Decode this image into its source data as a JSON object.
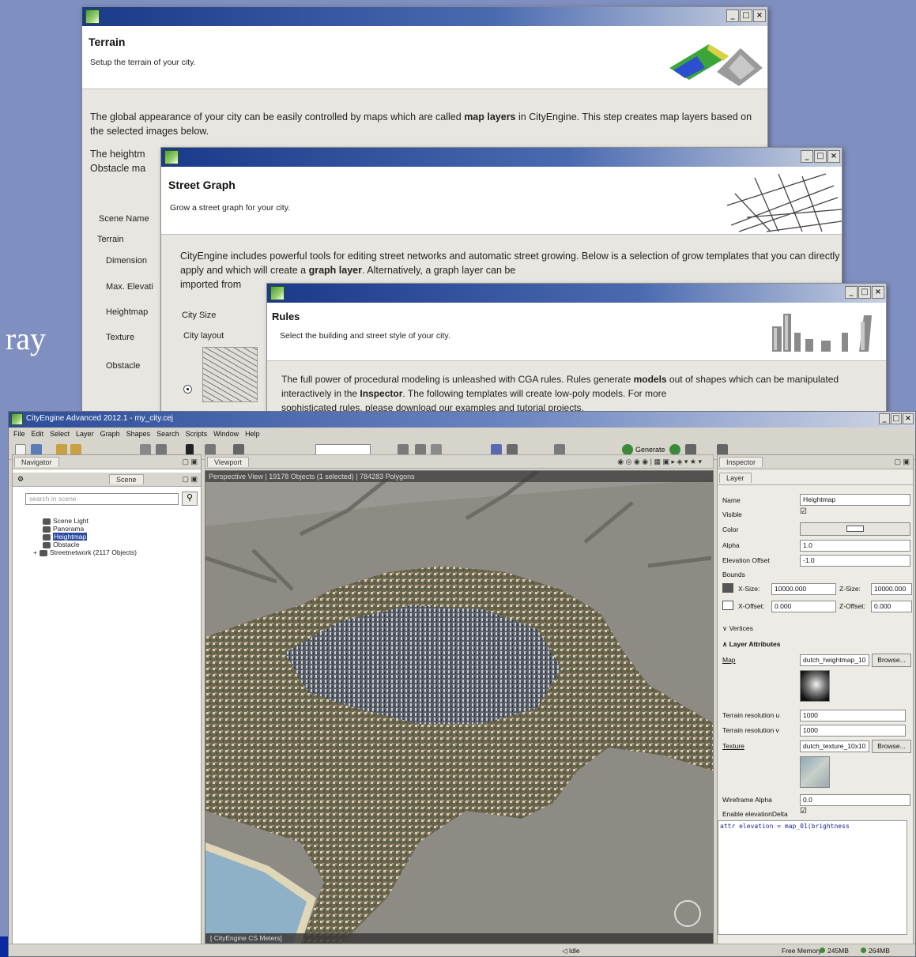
{
  "slide_text": "ray",
  "terrain_window": {
    "title": "Terrain",
    "subtitle": "Setup the terrain of your city.",
    "body": [
      "The global appearance of your city can be easily controlled by maps which are called ",
      "map layers",
      " in CityEngine. This step creates map layers based on the selected images below."
    ],
    "body2_line1": "The heightm",
    "body2_line2": "Obstacle ma",
    "scene_name_label": "Scene Name",
    "terrain_group": "Terrain",
    "labels": [
      "Dimension",
      "Max. Elevati",
      "Heightmap",
      "Texture",
      "Obstacle"
    ]
  },
  "street_window": {
    "title": "Street Graph",
    "subtitle": "Grow a street graph for your city.",
    "body_a": "CityEngine includes powerful tools for editing street networks and automatic street growing. Below is a selection of grow templates that you can directly apply and which will create a ",
    "body_bold": "graph layer",
    "body_b": ". Alternatively, a graph layer can be",
    "body_c": "imported from",
    "city_size_label": "City Size",
    "city_layout_label": "City layout"
  },
  "rules_window": {
    "title": "Rules",
    "subtitle": "Select the building and street style of your city.",
    "body_1a": "The full power of procedural modeling is unleashed with CGA rules. Rules generate ",
    "body_1b": "models",
    "body_1c": " out of shapes which can be manipulated interactively in the ",
    "body_1d": "Inspector",
    "body_1e": ". The following templates will create low-poly models. For more",
    "body_2": "sophisticated rules, please download our examples and tutorial projects."
  },
  "window_controls": {
    "minimize": "_",
    "maximize": "□",
    "close": "×"
  },
  "app": {
    "title": "CityEngine Advanced 2012.1 - my_city.cej",
    "menu": [
      "File",
      "Edit",
      "Select",
      "Layer",
      "Graph",
      "Shapes",
      "Search",
      "Scripts",
      "Window",
      "Help"
    ],
    "generate_label": "Generate",
    "navigator_tab": "Navigator",
    "scene_tab": "Scene",
    "search_placeholder": "search in scene",
    "scene_items": [
      "Scene Light",
      "Panorama",
      "Heightmap",
      "Obstacle",
      "Streetnetwork (2117 Objects)"
    ],
    "viewport_tab": "Viewport",
    "viewport_status": "Perspective View | 19178 Objects (1 selected) | 784283 Polygons",
    "viewport_footer": "[ CityEngine CS Meters]",
    "inspector_tab": "Inspector",
    "layer_tab": "Layer",
    "props": {
      "name_label": "Name",
      "name_value": "Heightmap",
      "visible_label": "Visible",
      "visible_value": "☑",
      "color_label": "Color",
      "alpha_label": "Alpha",
      "alpha_value": "1.0",
      "elev_label": "Elevation Offset",
      "elev_value": "-1.0",
      "bounds_label": "Bounds",
      "xsize_label": "X-Size:",
      "xsize_value": "10000.000",
      "zsize_label": "Z-Size:",
      "zsize_value": "10000.000",
      "xoff_label": "X-Offset:",
      "xoff_value": "0.000",
      "zoff_label": "Z-Offset:",
      "zoff_value": "0.000",
      "vertices_label": "Vertices",
      "layer_attr_label": "Layer Attributes",
      "map_label": "Map",
      "map_value": "dutch_heightmap_10",
      "browse": "Browse...",
      "tres_u_label": "Terrain resolution u",
      "tres_u_value": "1000",
      "tres_v_label": "Terrain resolution v",
      "tres_v_value": "1000",
      "texture_label": "Texture",
      "texture_value": "dutch_texture_10x10",
      "wire_label": "Wireframe Alpha",
      "wire_value": "0.0",
      "enable_label": "Enable elevationDelta",
      "enable_value": "☑",
      "attr_code": "attr elevation = map_01(brightness"
    },
    "status": {
      "idle": "Idle",
      "free_memory": "Free Memory:",
      "mem1": "245MB",
      "mem2": "264MB"
    }
  }
}
